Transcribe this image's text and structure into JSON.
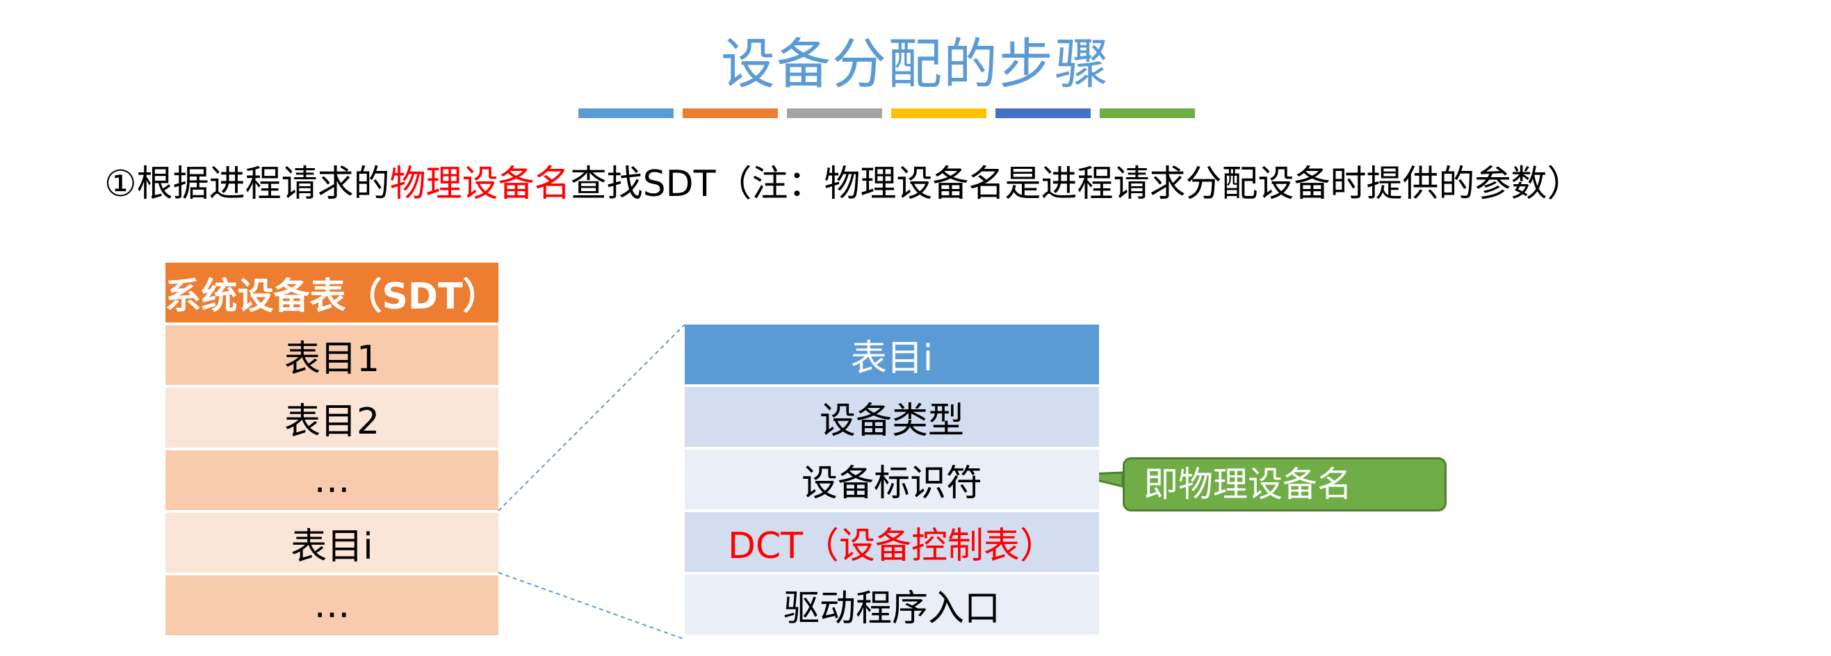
{
  "title": "设备分配的步骤",
  "color_bars": [
    "#5b9bd5",
    "#ed7d31",
    "#a5a5a5",
    "#ffc000",
    "#4472c4",
    "#70ad47"
  ],
  "intro": {
    "prefix": "①根据进程请求的",
    "highlight": "物理设备名",
    "suffix": "查找SDT（注：物理设备名是进程请求分配设备时提供的参数）"
  },
  "sdt_table": {
    "header": "系统设备表（SDT）",
    "rows": [
      "表目1",
      "表目2",
      "…",
      "表目i",
      "…"
    ]
  },
  "entry_table": {
    "header": "表目i",
    "rows": [
      "设备类型",
      "设备标识符",
      "DCT（设备控制表）",
      "驱动程序入口"
    ]
  },
  "callout": "即物理设备名"
}
